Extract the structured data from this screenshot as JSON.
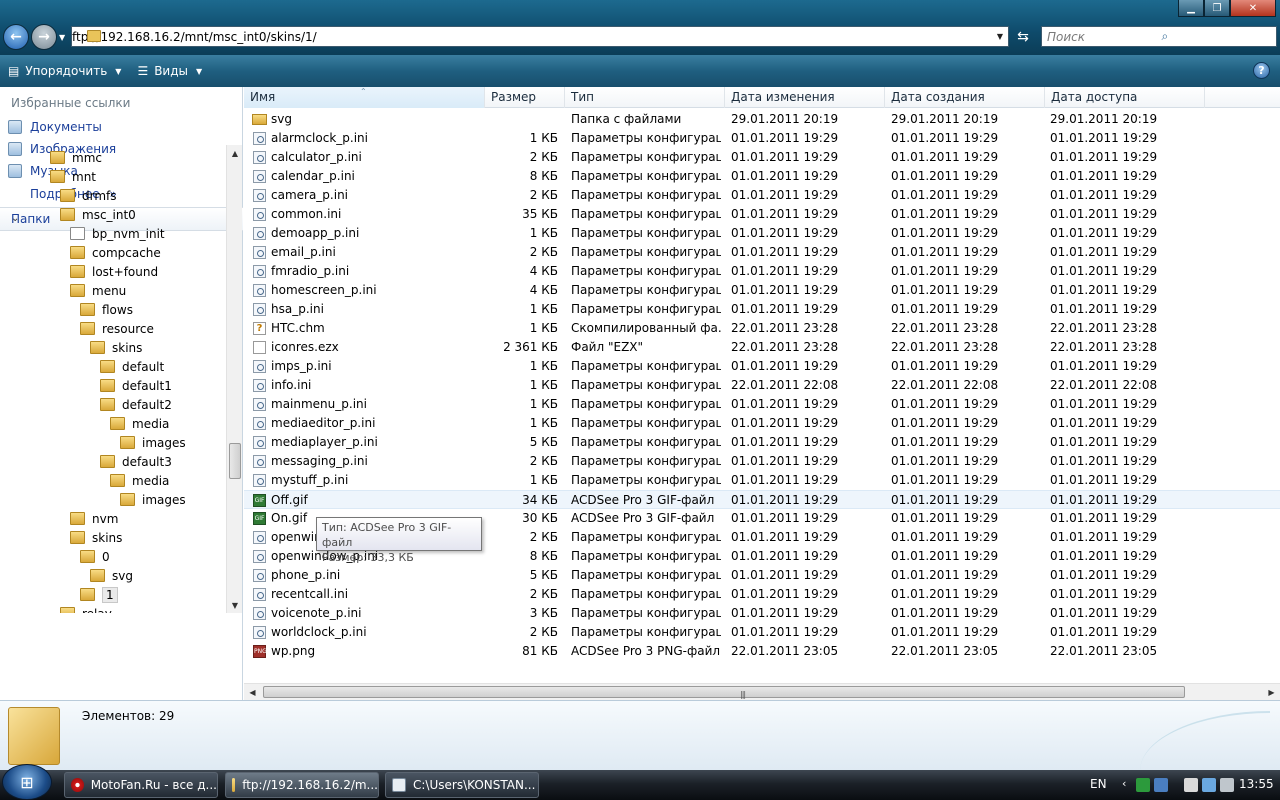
{
  "address": {
    "path": "ftp://192.168.16.2/mnt/msc_int0/skins/1/"
  },
  "search": {
    "placeholder": "Поиск"
  },
  "toolbar": {
    "organize_label": "Упорядочить",
    "views_label": "Виды"
  },
  "favorites": {
    "title": "Избранные ссылки",
    "items": [
      {
        "label": "Документы"
      },
      {
        "label": "Изображения"
      },
      {
        "label": "Музыка"
      }
    ],
    "more_label": "Подробнее",
    "more_chevron": "»"
  },
  "folders_header": "Папки",
  "tree": [
    {
      "label": "mmc",
      "depth": 0
    },
    {
      "label": "mnt",
      "depth": 0
    },
    {
      "label": "drmfs",
      "depth": 1
    },
    {
      "label": "msc_int0",
      "depth": 1
    },
    {
      "label": "bp_nvm_init",
      "depth": 2,
      "link": true
    },
    {
      "label": "compcache",
      "depth": 2
    },
    {
      "label": "lost+found",
      "depth": 2
    },
    {
      "label": "menu",
      "depth": 2
    },
    {
      "label": "flows",
      "depth": 3
    },
    {
      "label": "resource",
      "depth": 3
    },
    {
      "label": "skins",
      "depth": 4
    },
    {
      "label": "default",
      "depth": 5
    },
    {
      "label": "default1",
      "depth": 5
    },
    {
      "label": "default2",
      "depth": 5
    },
    {
      "label": "media",
      "depth": 6
    },
    {
      "label": "images",
      "depth": 7
    },
    {
      "label": "default3",
      "depth": 5
    },
    {
      "label": "media",
      "depth": 6
    },
    {
      "label": "images",
      "depth": 7
    },
    {
      "label": "nvm",
      "depth": 2
    },
    {
      "label": "skins",
      "depth": 2
    },
    {
      "label": "0",
      "depth": 3
    },
    {
      "label": "svg",
      "depth": 4
    },
    {
      "label": "1",
      "depth": 3,
      "selected": true
    },
    {
      "label": "relay",
      "depth": 1
    }
  ],
  "columns": {
    "name": "Имя",
    "size": "Размер",
    "type": "Тип",
    "modified": "Дата изменения",
    "created": "Дата создания",
    "accessed": "Дата доступа"
  },
  "files": [
    {
      "name": "svg",
      "icon": "folder-icon",
      "size": "",
      "type": "Папка с файлами",
      "modified": "29.01.2011 20:19",
      "created": "29.01.2011 20:19",
      "accessed": "29.01.2011 20:19"
    },
    {
      "name": "alarmclock_p.ini",
      "icon": "ini-file-icon",
      "size": "1 КБ",
      "type": "Параметры конфигурац...",
      "modified": "01.01.2011 19:29",
      "created": "01.01.2011 19:29",
      "accessed": "01.01.2011 19:29"
    },
    {
      "name": "calculator_p.ini",
      "icon": "ini-file-icon",
      "size": "2 КБ",
      "type": "Параметры конфигурац...",
      "modified": "01.01.2011 19:29",
      "created": "01.01.2011 19:29",
      "accessed": "01.01.2011 19:29"
    },
    {
      "name": "calendar_p.ini",
      "icon": "ini-file-icon",
      "size": "8 КБ",
      "type": "Параметры конфигурац...",
      "modified": "01.01.2011 19:29",
      "created": "01.01.2011 19:29",
      "accessed": "01.01.2011 19:29"
    },
    {
      "name": "camera_p.ini",
      "icon": "ini-file-icon",
      "size": "2 КБ",
      "type": "Параметры конфигурац...",
      "modified": "01.01.2011 19:29",
      "created": "01.01.2011 19:29",
      "accessed": "01.01.2011 19:29"
    },
    {
      "name": "common.ini",
      "icon": "ini-file-icon",
      "size": "35 КБ",
      "type": "Параметры конфигурац...",
      "modified": "01.01.2011 19:29",
      "created": "01.01.2011 19:29",
      "accessed": "01.01.2011 19:29"
    },
    {
      "name": "demoapp_p.ini",
      "icon": "ini-file-icon",
      "size": "1 КБ",
      "type": "Параметры конфигурац...",
      "modified": "01.01.2011 19:29",
      "created": "01.01.2011 19:29",
      "accessed": "01.01.2011 19:29"
    },
    {
      "name": "email_p.ini",
      "icon": "ini-file-icon",
      "size": "2 КБ",
      "type": "Параметры конфигурац...",
      "modified": "01.01.2011 19:29",
      "created": "01.01.2011 19:29",
      "accessed": "01.01.2011 19:29"
    },
    {
      "name": "fmradio_p.ini",
      "icon": "ini-file-icon",
      "size": "4 КБ",
      "type": "Параметры конфигурац...",
      "modified": "01.01.2011 19:29",
      "created": "01.01.2011 19:29",
      "accessed": "01.01.2011 19:29"
    },
    {
      "name": "homescreen_p.ini",
      "icon": "ini-file-icon",
      "size": "4 КБ",
      "type": "Параметры конфигурац...",
      "modified": "01.01.2011 19:29",
      "created": "01.01.2011 19:29",
      "accessed": "01.01.2011 19:29"
    },
    {
      "name": "hsa_p.ini",
      "icon": "ini-file-icon",
      "size": "1 КБ",
      "type": "Параметры конфигурац...",
      "modified": "01.01.2011 19:29",
      "created": "01.01.2011 19:29",
      "accessed": "01.01.2011 19:29"
    },
    {
      "name": "HTC.chm",
      "icon": "chm-file-icon",
      "size": "1 КБ",
      "type": "Скомпилированный фа...",
      "modified": "22.01.2011 23:28",
      "created": "22.01.2011 23:28",
      "accessed": "22.01.2011 23:28"
    },
    {
      "name": "iconres.ezx",
      "icon": "blank-file-icon",
      "size": "2 361 КБ",
      "type": "Файл \"EZX\"",
      "modified": "22.01.2011 23:28",
      "created": "22.01.2011 23:28",
      "accessed": "22.01.2011 23:28"
    },
    {
      "name": "imps_p.ini",
      "icon": "ini-file-icon",
      "size": "1 КБ",
      "type": "Параметры конфигурац...",
      "modified": "01.01.2011 19:29",
      "created": "01.01.2011 19:29",
      "accessed": "01.01.2011 19:29"
    },
    {
      "name": "info.ini",
      "icon": "ini-file-icon",
      "size": "1 КБ",
      "type": "Параметры конфигурац...",
      "modified": "22.01.2011 22:08",
      "created": "22.01.2011 22:08",
      "accessed": "22.01.2011 22:08"
    },
    {
      "name": "mainmenu_p.ini",
      "icon": "ini-file-icon",
      "size": "1 КБ",
      "type": "Параметры конфигурац...",
      "modified": "01.01.2011 19:29",
      "created": "01.01.2011 19:29",
      "accessed": "01.01.2011 19:29"
    },
    {
      "name": "mediaeditor_p.ini",
      "icon": "ini-file-icon",
      "size": "1 КБ",
      "type": "Параметры конфигурац...",
      "modified": "01.01.2011 19:29",
      "created": "01.01.2011 19:29",
      "accessed": "01.01.2011 19:29"
    },
    {
      "name": "mediaplayer_p.ini",
      "icon": "ini-file-icon",
      "size": "5 КБ",
      "type": "Параметры конфигурац...",
      "modified": "01.01.2011 19:29",
      "created": "01.01.2011 19:29",
      "accessed": "01.01.2011 19:29"
    },
    {
      "name": "messaging_p.ini",
      "icon": "ini-file-icon",
      "size": "2 КБ",
      "type": "Параметры конфигурац...",
      "modified": "01.01.2011 19:29",
      "created": "01.01.2011 19:29",
      "accessed": "01.01.2011 19:29"
    },
    {
      "name": "mystuff_p.ini",
      "icon": "ini-file-icon",
      "size": "1 КБ",
      "type": "Параметры конфигурац...",
      "modified": "01.01.2011 19:29",
      "created": "01.01.2011 19:29",
      "accessed": "01.01.2011 19:29"
    },
    {
      "name": "Off.gif",
      "icon": "gif-file-icon",
      "size": "34 КБ",
      "type": "ACDSee Pro 3 GIF-файл",
      "modified": "01.01.2011 19:29",
      "created": "01.01.2011 19:29",
      "accessed": "01.01.2011 19:29",
      "hover": true
    },
    {
      "name": "On.gif",
      "icon": "gif-file-icon",
      "size": "30 КБ",
      "type": "ACDSee Pro 3 GIF-файл",
      "modified": "01.01.2011 19:29",
      "created": "01.01.2011 19:29",
      "accessed": "01.01.2011 19:29"
    },
    {
      "name": "openwin",
      "icon": "ini-file-icon",
      "size": "2 КБ",
      "type": "Параметры конфигурац...",
      "modified": "01.01.2011 19:29",
      "created": "01.01.2011 19:29",
      "accessed": "01.01.2011 19:29"
    },
    {
      "name": "openwindow_p.ini",
      "icon": "ini-file-icon",
      "size": "8 КБ",
      "type": "Параметры конфигурац...",
      "modified": "01.01.2011 19:29",
      "created": "01.01.2011 19:29",
      "accessed": "01.01.2011 19:29"
    },
    {
      "name": "phone_p.ini",
      "icon": "ini-file-icon",
      "size": "5 КБ",
      "type": "Параметры конфигурац...",
      "modified": "01.01.2011 19:29",
      "created": "01.01.2011 19:29",
      "accessed": "01.01.2011 19:29"
    },
    {
      "name": "recentcall.ini",
      "icon": "ini-file-icon",
      "size": "2 КБ",
      "type": "Параметры конфигурац...",
      "modified": "01.01.2011 19:29",
      "created": "01.01.2011 19:29",
      "accessed": "01.01.2011 19:29"
    },
    {
      "name": "voicenote_p.ini",
      "icon": "ini-file-icon",
      "size": "3 КБ",
      "type": "Параметры конфигурац...",
      "modified": "01.01.2011 19:29",
      "created": "01.01.2011 19:29",
      "accessed": "01.01.2011 19:29"
    },
    {
      "name": "worldclock_p.ini",
      "icon": "ini-file-icon",
      "size": "2 КБ",
      "type": "Параметры конфигурац...",
      "modified": "01.01.2011 19:29",
      "created": "01.01.2011 19:29",
      "accessed": "01.01.2011 19:29"
    },
    {
      "name": "wp.png",
      "icon": "png-file-icon",
      "size": "81 КБ",
      "type": "ACDSee Pro 3 PNG-файл",
      "modified": "22.01.2011 23:05",
      "created": "22.01.2011 23:05",
      "accessed": "22.01.2011 23:05"
    }
  ],
  "tooltip": {
    "type_line": "Тип: ACDSee Pro 3 GIF-файл",
    "size_line": "Размер: 33,3 КБ"
  },
  "details": {
    "count": "Элементов: 29"
  },
  "taskbar": {
    "items": [
      {
        "label": "MotoFan.Ru - все д...",
        "icon": "opera-icon"
      },
      {
        "label": "ftp://192.168.16.2/m...",
        "icon": "explorer-folder-icon",
        "active": true
      },
      {
        "label": "C:\\Users\\KONSTAN...",
        "icon": "notepad-icon"
      }
    ],
    "lang": "EN",
    "clock": "13:55"
  }
}
